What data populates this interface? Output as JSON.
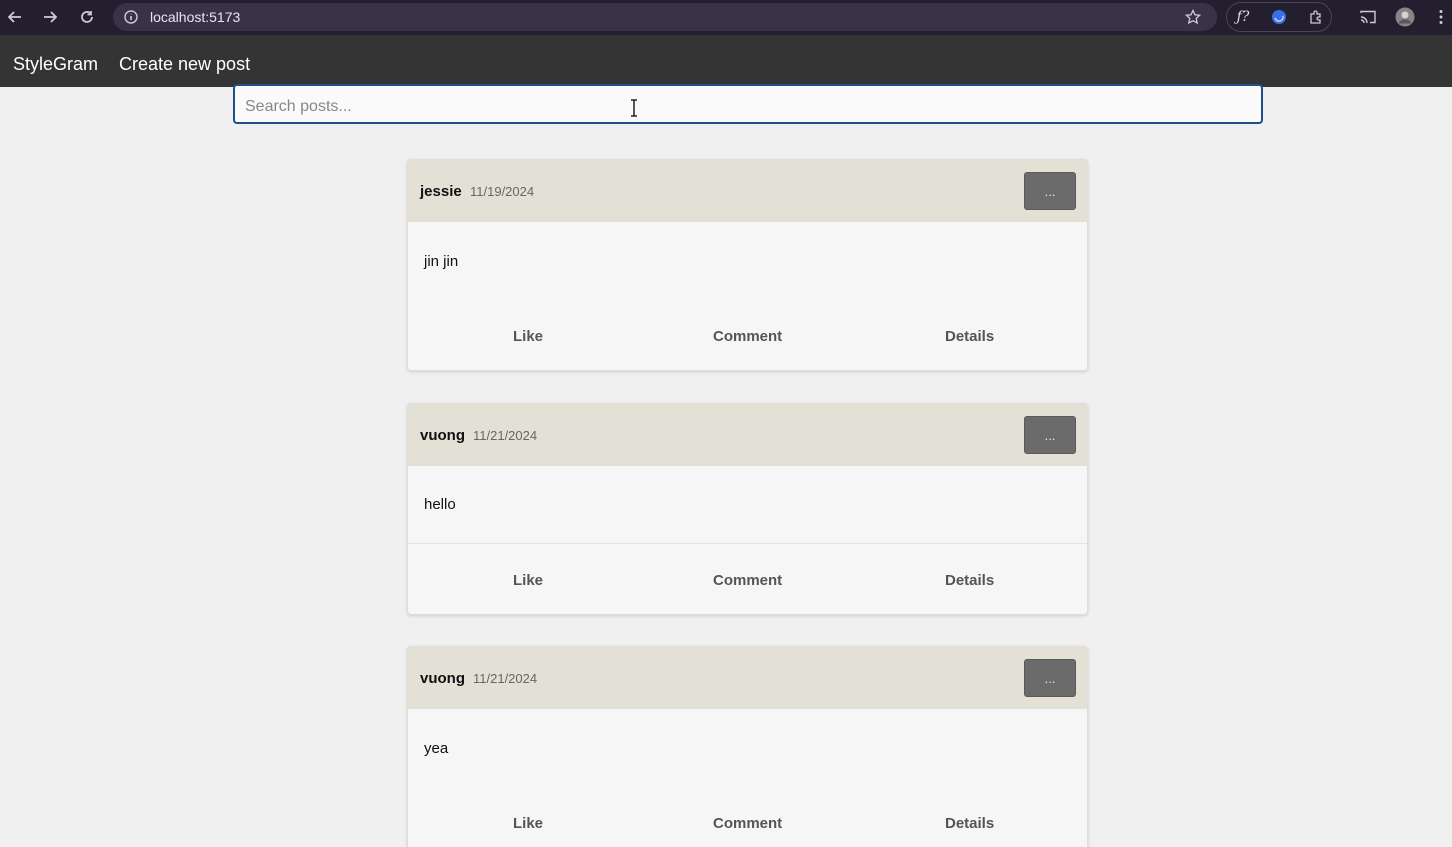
{
  "browser": {
    "url": "localhost:5173"
  },
  "header": {
    "brand": "StyleGram",
    "create_link": "Create new post"
  },
  "search": {
    "placeholder": "Search posts..."
  },
  "posts": [
    {
      "author": "jessie",
      "date": "11/19/2024",
      "content": "jin jin",
      "more_label": "...",
      "like_label": "Like",
      "comment_label": "Comment",
      "details_label": "Details"
    },
    {
      "author": "vuong",
      "date": "11/21/2024",
      "content": "hello",
      "more_label": "...",
      "like_label": "Like",
      "comment_label": "Comment",
      "details_label": "Details"
    },
    {
      "author": "vuong",
      "date": "11/21/2024",
      "content": "yea",
      "more_label": "...",
      "like_label": "Like",
      "comment_label": "Comment",
      "details_label": "Details"
    }
  ],
  "icons": [
    "back-arrow-icon",
    "forward-arrow-icon",
    "reload-icon",
    "site-info-icon",
    "star-icon",
    "extension-fx-icon",
    "extension-blue-icon",
    "puzzle-icon",
    "cast-icon",
    "profile-avatar-icon",
    "menu-dots-icon",
    "text-cursor-icon"
  ],
  "colors": {
    "chrome_bg": "#241f2e",
    "app_header_bg": "#343434",
    "card_header_bg": "#e3e1d6",
    "more_button_bg": "#6b6b6b",
    "search_border": "#1f4f8a"
  }
}
